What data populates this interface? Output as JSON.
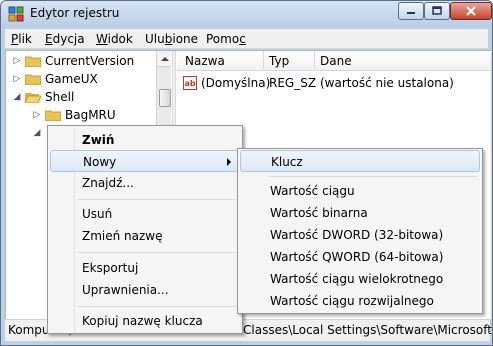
{
  "window": {
    "title": "Edytor rejestru"
  },
  "menubar": [
    {
      "pre": "",
      "u": "P",
      "post": "lik"
    },
    {
      "pre": "",
      "u": "E",
      "post": "dycja"
    },
    {
      "pre": "",
      "u": "W",
      "post": "idok"
    },
    {
      "pre": "Ulu",
      "u": "b",
      "post": "ione"
    },
    {
      "pre": "Pomo",
      "u": "c",
      "post": ""
    }
  ],
  "tree": {
    "items": [
      {
        "label": "CurrentVersion",
        "expander": "▷"
      },
      {
        "label": "GameUX",
        "expander": "▷"
      },
      {
        "label": "Shell",
        "expander": "◢"
      },
      {
        "label": "BagMRU",
        "expander": "▷"
      },
      {
        "label": "",
        "expander": "◢"
      }
    ]
  },
  "list": {
    "columns": [
      "Nazwa",
      "Typ",
      "Dane"
    ],
    "rows": [
      {
        "name": "(Domyślna)",
        "type": "REG_SZ",
        "data": "(wartość nie ustalona)"
      }
    ]
  },
  "statusbar": {
    "path_left": "Komputer\\",
    "path_right": "Classes\\Local Settings\\Software\\Microsoft'"
  },
  "context_menu": {
    "items": [
      {
        "label": "Zwiń"
      },
      {
        "label": "Nowy"
      },
      {
        "label": "Znajdź..."
      },
      {
        "label": "Usuń"
      },
      {
        "label": "Zmień nazwę"
      },
      {
        "label": "Eksportuj"
      },
      {
        "label": "Uprawnienia..."
      },
      {
        "label": "Kopiuj nazwę klucza"
      }
    ]
  },
  "submenu": {
    "items": [
      {
        "label": "Klucz"
      },
      {
        "label": "Wartość ciągu"
      },
      {
        "label": "Wartość binarna"
      },
      {
        "label": "Wartość DWORD (32-bitowa)"
      },
      {
        "label": "Wartość QWORD (64-bitowa)"
      },
      {
        "label": "Wartość ciągu wielokrotnego"
      },
      {
        "label": "Wartość ciągu rozwijalnego"
      }
    ]
  },
  "colors": {
    "accent": "#a8c6ea",
    "folder": "#e9c454",
    "close": "#c7442f"
  }
}
